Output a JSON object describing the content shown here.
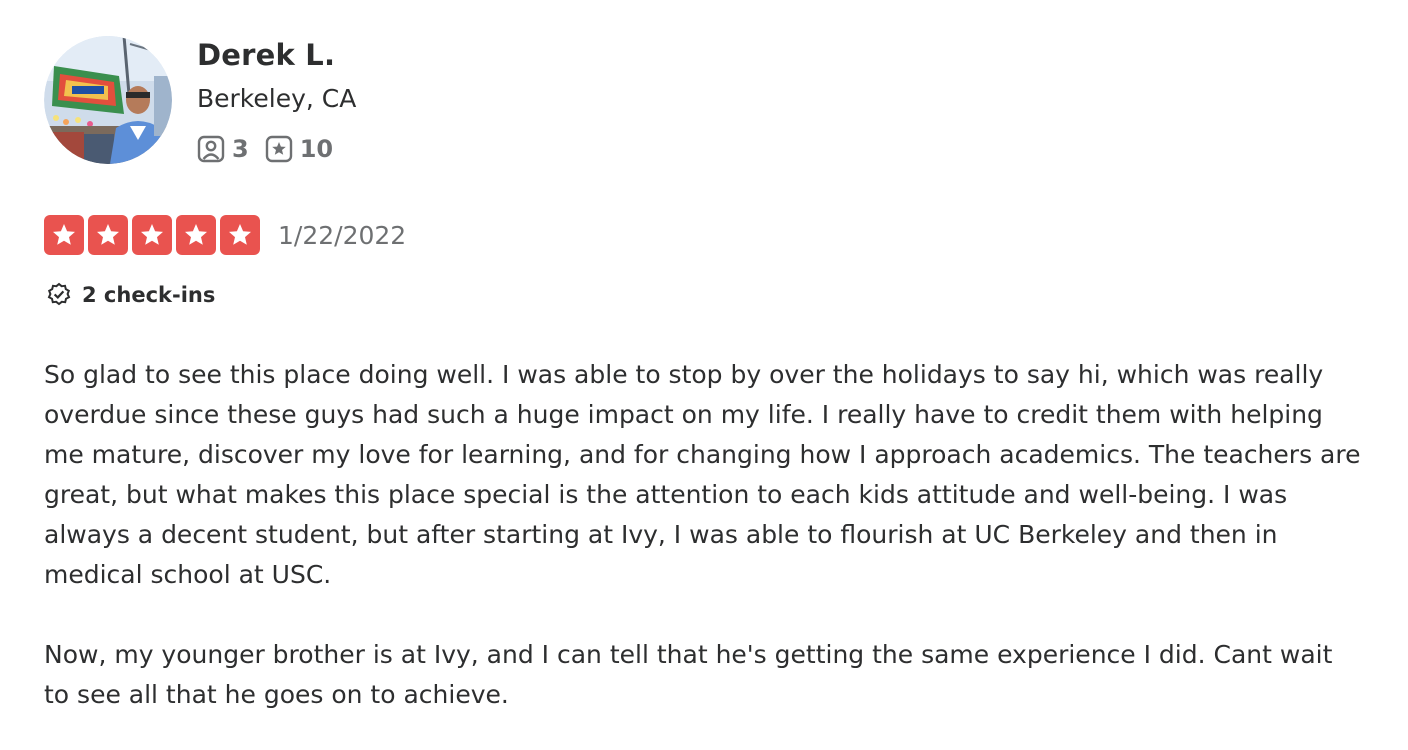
{
  "user": {
    "name": "Derek L.",
    "location": "Berkeley, CA",
    "friends_count": "3",
    "reviews_count": "10",
    "friends_icon": "friends-icon",
    "reviews_icon": "review-star-icon"
  },
  "review": {
    "rating": 5,
    "max_rating": 5,
    "star_color": "#e9534f",
    "date": "1/22/2022",
    "checkins": "2 check-ins",
    "paragraphs": [
      "So glad to see this place doing well. I was able to stop by over the holidays to say hi, which was really overdue since these guys had such a huge impact on my life. I really have to credit them with helping me mature, discover my love for learning, and for changing how I approach academics. The teachers are great, but what makes this place special is the attention to each kids attitude and well-being. I was always a decent student, but after starting at Ivy, I was able to flourish at UC Berkeley and then in medical school at USC.",
      "Now, my younger brother is at Ivy, and I can tell that he's getting the same experience I did. Cant wait to see all that he goes on to achieve."
    ]
  }
}
